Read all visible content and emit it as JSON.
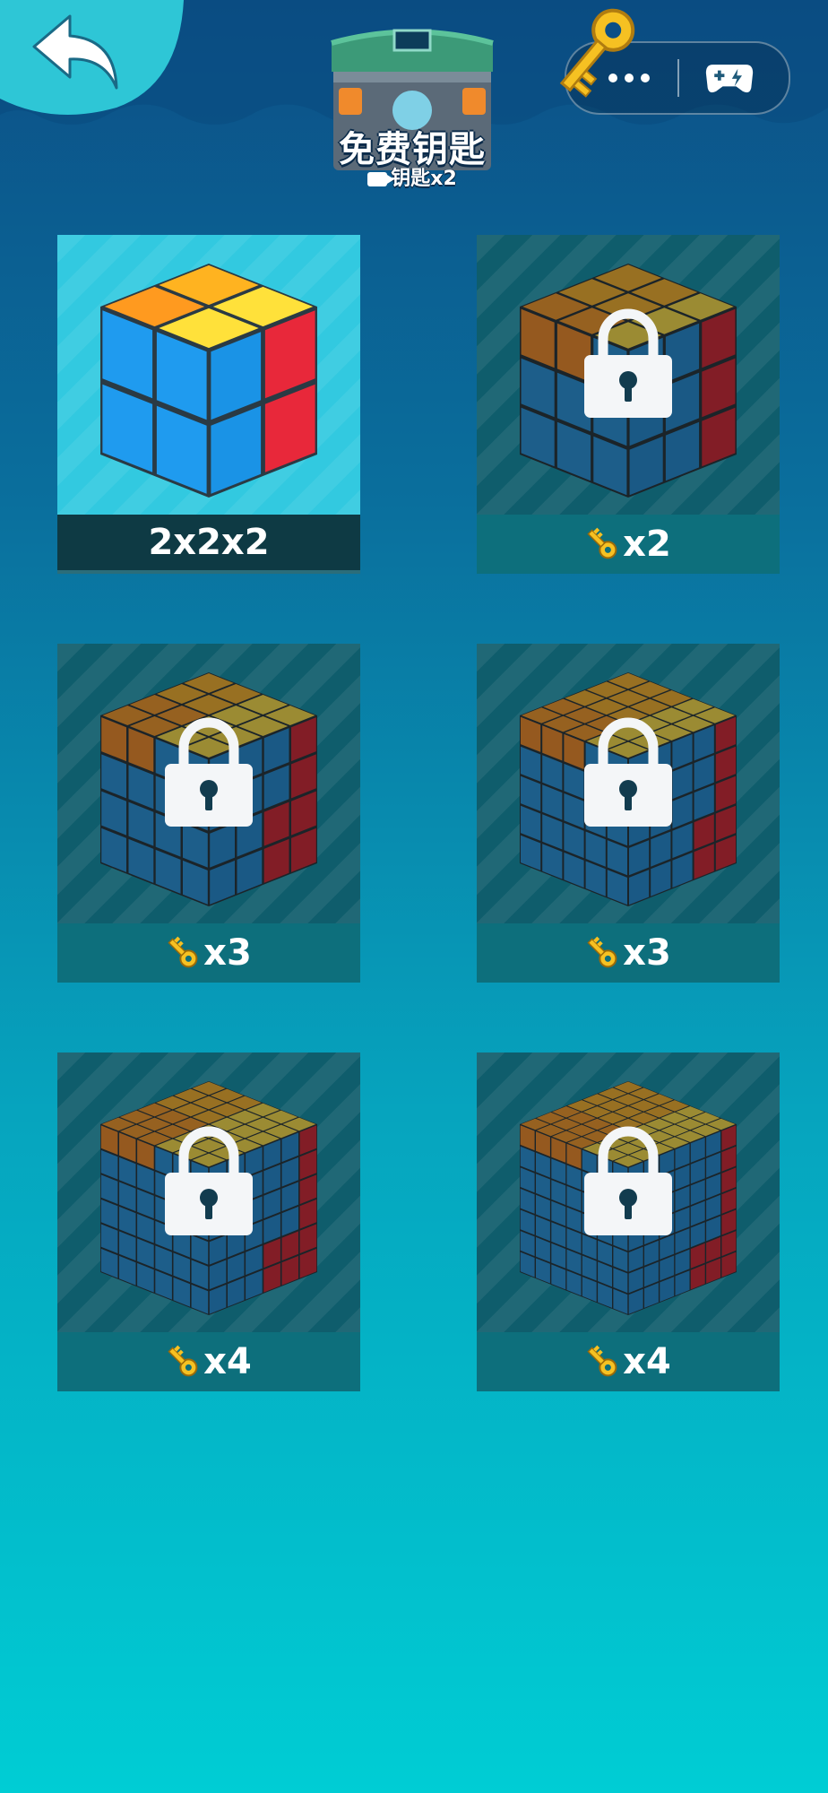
{
  "header": {
    "back_icon": "back-arrow-icon",
    "chest_title": "免费钥匙",
    "chest_subtitle": "钥匙x2",
    "capsule_more_icon": "more-dots-icon",
    "capsule_game_icon": "gamepad-icon"
  },
  "colors": {
    "locked_tile": "#0f5d6c",
    "selected_tile": "#32c9e0",
    "selected_footer": "#0e3a44",
    "locked_footer": "#0d6f7c"
  },
  "cubes": [
    {
      "label": "2x2x2",
      "locked": false,
      "size": 2
    },
    {
      "label": "x2",
      "locked": true,
      "size": 3
    },
    {
      "label": "x3",
      "locked": true,
      "size": 4
    },
    {
      "label": "x3",
      "locked": true,
      "size": 5
    },
    {
      "label": "x4",
      "locked": true,
      "size": 6
    },
    {
      "label": "x4",
      "locked": true,
      "size": 7
    }
  ]
}
